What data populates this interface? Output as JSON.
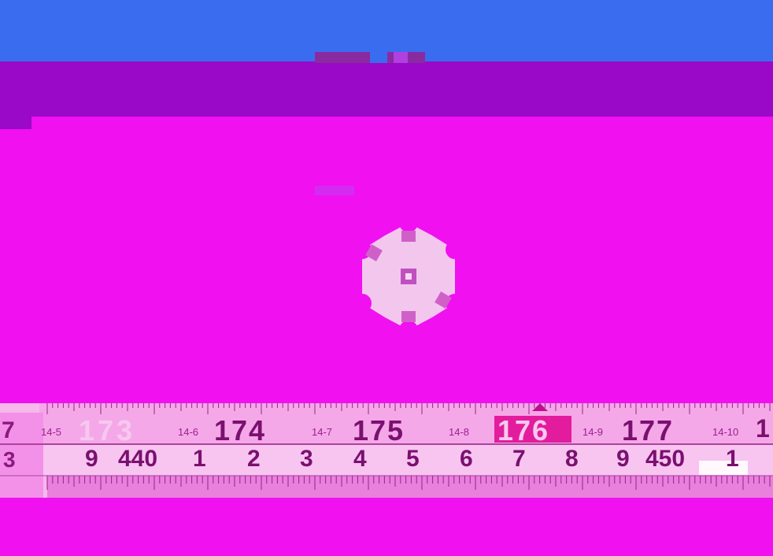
{
  "colors": {
    "sky_blue": "#3a6cf0",
    "purple_band": "#9a08c8",
    "magenta": "#f010f0",
    "tape_light": "#f7b8ec",
    "tape_dark": "#e060d8",
    "ink": "#7a1070",
    "pcb": "#f3c6ee"
  },
  "ruler": {
    "top_numbers": [
      "173",
      "174",
      "175",
      "176",
      "177",
      "1"
    ],
    "top_labels": [
      "14-5",
      "14-6",
      "14-7",
      "14-8",
      "14-9",
      "14-10"
    ],
    "bottom_numbers": [
      "9",
      "440",
      "1",
      "2",
      "3",
      "4",
      "5",
      "6",
      "7",
      "8",
      "9",
      "450",
      "1"
    ],
    "edge_top": "7",
    "edge_bottom": "3"
  },
  "led": {
    "shape": "star-board",
    "pads": 6
  }
}
